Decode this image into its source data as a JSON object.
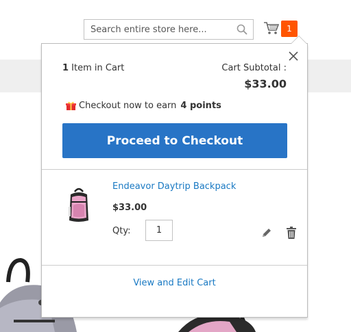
{
  "header": {
    "search_placeholder": "Search entire store here...",
    "cart_count": "1"
  },
  "minicart": {
    "items_count_number": "1",
    "items_count_label": " Item in Cart",
    "subtotal_label": "Cart Subtotal :",
    "subtotal_amount": "$33.00",
    "reward_text": "Checkout now to earn",
    "reward_points": "4 points",
    "checkout_label": "Proceed to Checkout",
    "item": {
      "name": "Endeavor Daytrip Backpack",
      "price": "$33.00",
      "qty_label": "Qty:",
      "qty_value": "1"
    },
    "view_edit_label": "View and Edit Cart"
  },
  "colors": {
    "accent": "#2874c6",
    "badge": "#ff5501",
    "link": "#1979c3"
  }
}
